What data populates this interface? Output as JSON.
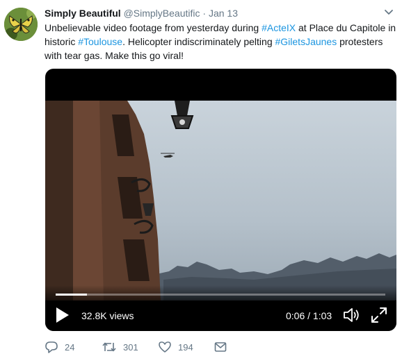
{
  "tweet": {
    "display_name": "Simply Beautiful",
    "handle": "@SimplyBeautific",
    "separator": "·",
    "timestamp": "Jan 13",
    "text_parts": {
      "p1": "Unbelievable video footage from yesterday during ",
      "h1": "#ActeIX",
      "p2": " at Place du Capitole in historic ",
      "h2": "#Toulouse",
      "p3": ".  Helicopter indiscriminately pelting ",
      "h3": "#GiletsJaunes",
      "p4": " protesters with tear gas.  Make this go viral!"
    }
  },
  "video": {
    "views": "32.8K views",
    "time": "0:06 / 1:03",
    "progress": 0.095
  },
  "actions": {
    "replies": "24",
    "retweets": "301",
    "likes": "194"
  },
  "colors": {
    "link": "#1b95e0",
    "secondary_text": "#657786",
    "primary_text": "#14171a"
  },
  "icons": {
    "avatar": "butterfly-avatar",
    "caret": "chevron-down-icon",
    "play": "play-icon",
    "volume": "volume-icon",
    "fullscreen": "fullscreen-icon",
    "reply": "reply-icon",
    "retweet": "retweet-icon",
    "like": "heart-icon",
    "dm": "envelope-icon"
  }
}
